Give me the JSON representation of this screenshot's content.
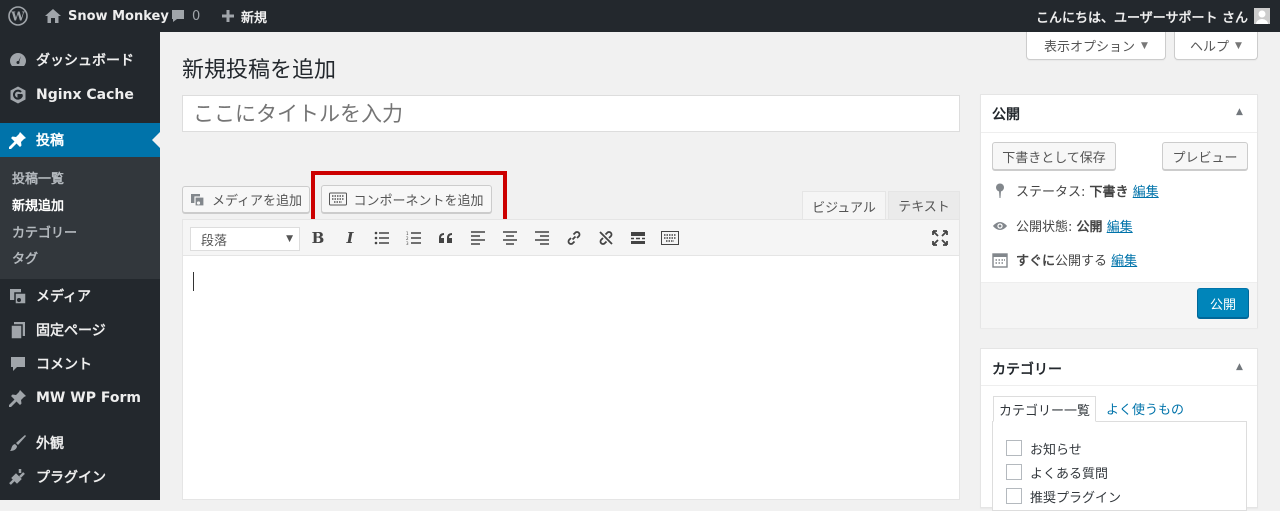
{
  "adminbar": {
    "site_name": "Snow Monkey",
    "comment_count": "0",
    "new_label": "新規",
    "greeting": "こんにちは、ユーザーサポート さん"
  },
  "sidebar": {
    "items": [
      {
        "label": "ダッシュボード",
        "icon": "dashboard-icon"
      },
      {
        "label": "Nginx Cache",
        "icon": "nginx-cache-icon"
      },
      {
        "label": "投稿",
        "icon": "pin-icon"
      },
      {
        "label": "メディア",
        "icon": "media-icon"
      },
      {
        "label": "固定ページ",
        "icon": "page-icon"
      },
      {
        "label": "コメント",
        "icon": "comment-icon"
      },
      {
        "label": "MW WP Form",
        "icon": "pin-icon"
      },
      {
        "label": "外観",
        "icon": "brush-icon"
      },
      {
        "label": "プラグイン",
        "icon": "plugin-icon"
      }
    ],
    "submenu": [
      "投稿一覧",
      "新規追加",
      "カテゴリー",
      "タグ"
    ]
  },
  "screen_options": "表示オプション",
  "help": "ヘルプ",
  "page_title": "新規投稿を追加",
  "title_placeholder": "ここにタイトルを入力",
  "editor": {
    "add_media": "メディアを追加",
    "add_component": "コンポーネントを追加",
    "tab_visual": "ビジュアル",
    "tab_text": "テキスト",
    "format_select": "段落"
  },
  "highlight_color": "#cc0000",
  "publish": {
    "title": "公開",
    "save_draft": "下書きとして保存",
    "preview": "プレビュー",
    "status_label": "ステータス:",
    "status_value": "下書き",
    "visibility_label": "公開状態:",
    "visibility_value": "公開",
    "schedule_prefix": "すぐに",
    "schedule_suffix": "公開する",
    "edit": "編集",
    "publish_button": "公開"
  },
  "categories": {
    "title": "カテゴリー",
    "tab_all": "カテゴリー一覧",
    "tab_popular": "よく使うもの",
    "items": [
      "お知らせ",
      "よくある質問",
      "推奨プラグイン"
    ]
  }
}
